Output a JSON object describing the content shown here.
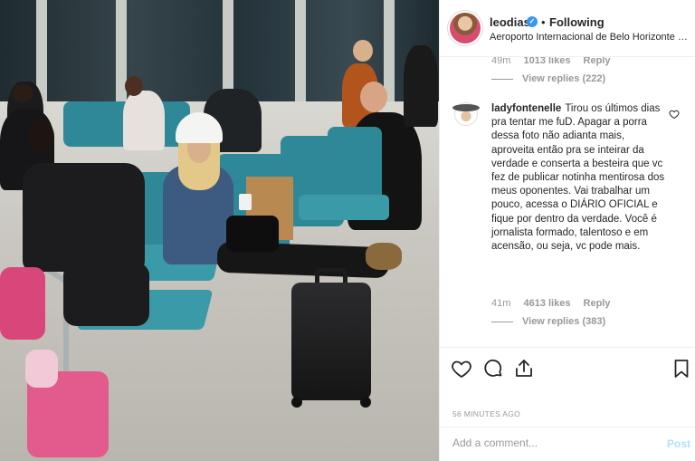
{
  "post": {
    "username": "leodias",
    "follow_separator": "•",
    "follow_status": "Following",
    "location": "Aeroporto Internacional de Belo Horizonte - C...",
    "verified_mark": "✓"
  },
  "comments": [
    {
      "time": "49m",
      "likes": "1013 likes",
      "reply_label": "Reply",
      "view_replies": "View replies (222)"
    },
    {
      "author": "ladyfontenelle",
      "text": "Tirou os últimos dias pra tentar me fuD. Apagar a porra dessa foto não adianta mais, aproveita então pra se inteirar da verdade e conserta a besteira que vc fez de publicar notinha mentirosa dos meus oponentes. Vai trabalhar um pouco, acessa o DIÁRIO OFICIAL e fique por dentro da verdade. Você é jornalista formado, talentoso e em acensão, ou seja, vc pode mais.",
      "time": "41m",
      "likes": "4613 likes",
      "reply_label": "Reply",
      "view_replies": "View replies (383)"
    }
  ],
  "actions": {
    "icons": [
      "heart-icon",
      "comment-icon",
      "share-icon",
      "bookmark-icon"
    ],
    "timestamp": "56 MINUTES AGO"
  },
  "add_comment": {
    "placeholder": "Add a comment...",
    "post_label": "Post"
  },
  "colors": {
    "verified": "#3897f0",
    "post_disabled": "#b2dffc",
    "muted": "#999999",
    "seat": "#3b9aa8"
  }
}
